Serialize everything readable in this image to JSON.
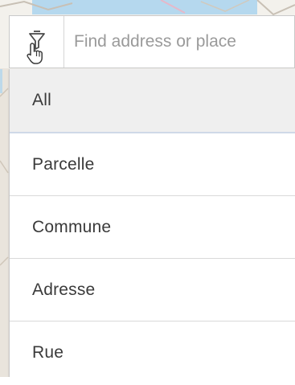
{
  "search": {
    "placeholder": "Find address or place",
    "value": ""
  },
  "filter": {
    "icon": "filter-icon",
    "cursor_icon": "hand-pointer-icon"
  },
  "dropdown": {
    "items": [
      {
        "label": "All",
        "selected": true
      },
      {
        "label": "Parcelle",
        "selected": false
      },
      {
        "label": "Commune",
        "selected": false
      },
      {
        "label": "Adresse",
        "selected": false
      },
      {
        "label": "Rue",
        "selected": false
      }
    ]
  },
  "colors": {
    "selected_item_bg": "#efefef",
    "selected_underline": "#cfd9e8",
    "map_water": "#a9d4ef",
    "map_land": "#f3f1ec"
  }
}
